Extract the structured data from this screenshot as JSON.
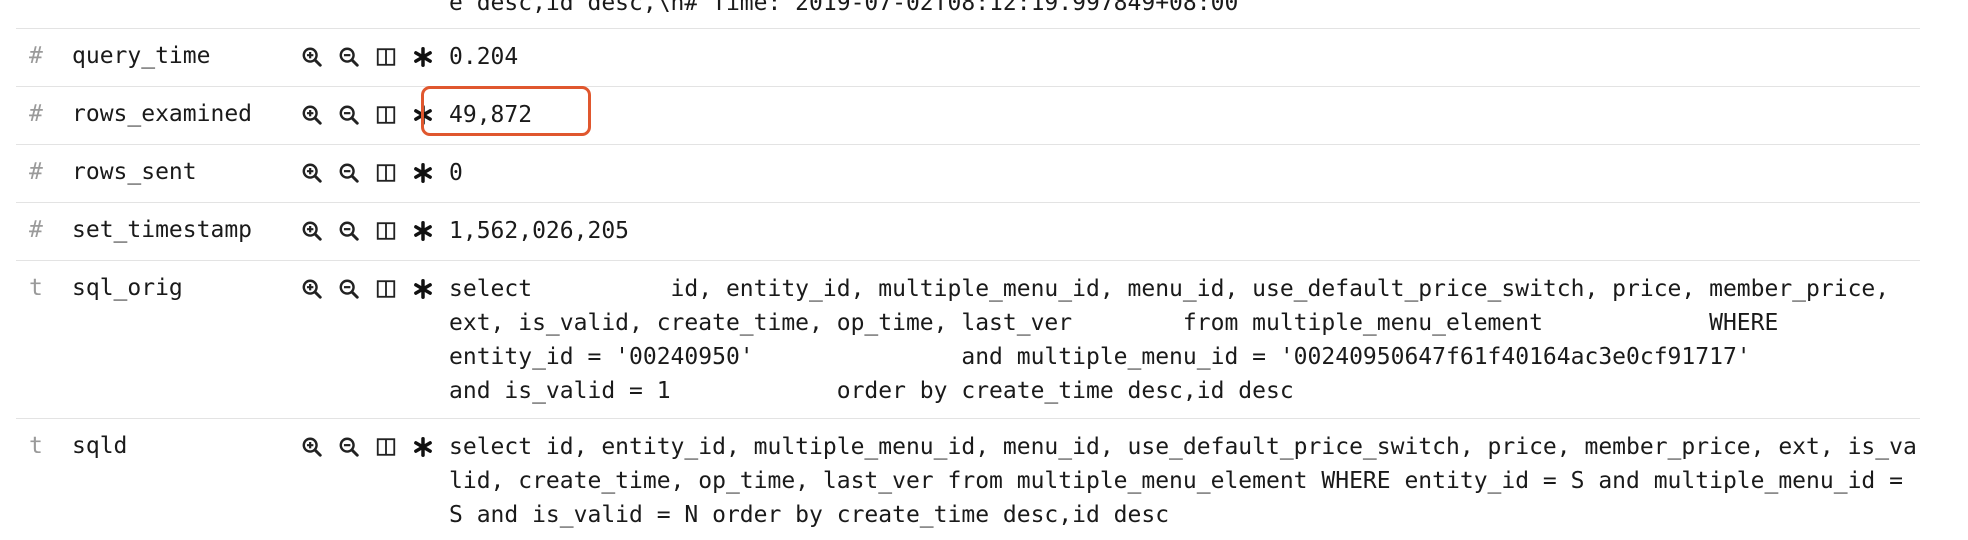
{
  "top_fragment": "e desc,id desc,\\n# Time: 2019-07-02T08:12:19.997849+08:00",
  "rows": [
    {
      "type": "#",
      "name": "query_time",
      "value": "0.204"
    },
    {
      "type": "#",
      "name": "rows_examined",
      "value": "49,872"
    },
    {
      "type": "#",
      "name": "rows_sent",
      "value": "0"
    },
    {
      "type": "#",
      "name": "set_timestamp",
      "value": "1,562,026,205"
    },
    {
      "type": "t",
      "name": "sql_orig",
      "value": "select          id, entity_id, multiple_menu_id, menu_id, use_default_price_switch, price, member_price,     ext, is_valid, create_time, op_time, last_ver        from multiple_menu_element            WHERE          entity_id = '00240950'               and multiple_menu_id = '00240950647f61f40164ac3e0cf91717'               and is_valid = 1            order by create_time desc,id desc"
    },
    {
      "type": "t",
      "name": "sqld",
      "value": "select id, entity_id, multiple_menu_id, menu_id, use_default_price_switch, price, member_price, ext, is_valid, create_time, op_time, last_ver from multiple_menu_element WHERE entity_id = S and multiple_menu_id = S and is_valid = N order by create_time desc,id desc"
    }
  ],
  "actions": [
    "zoom-in-icon",
    "zoom-out-icon",
    "toggle-column-icon",
    "exists-filter-icon"
  ],
  "highlight_color": "#e0572e"
}
